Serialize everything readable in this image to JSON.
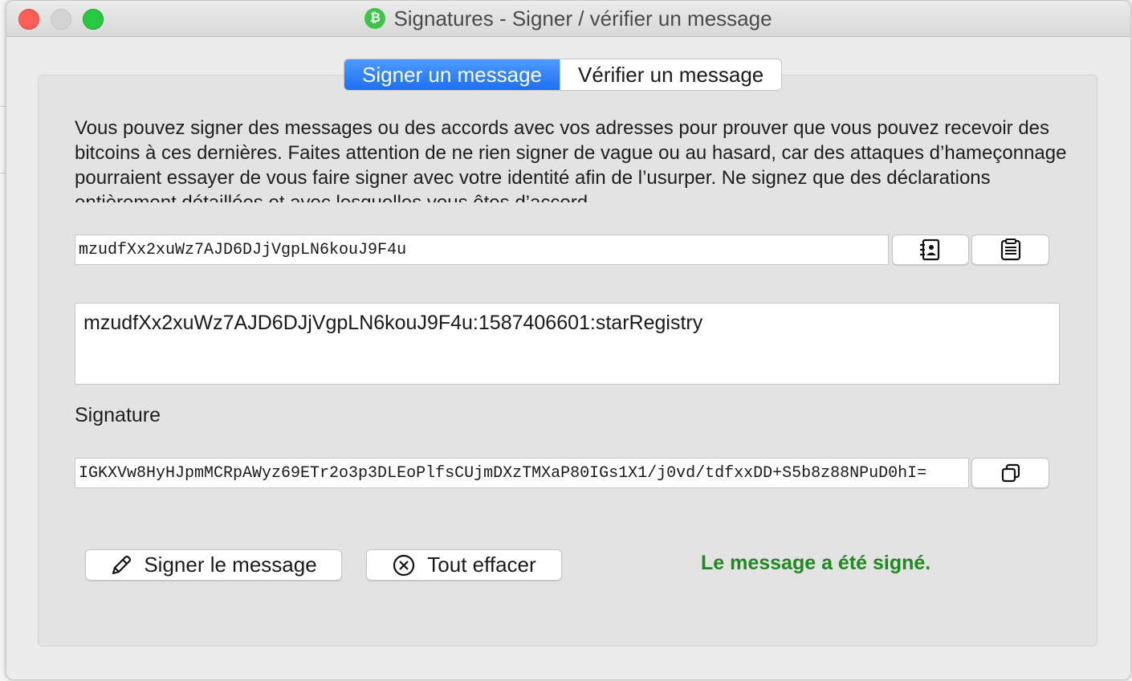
{
  "window": {
    "title": "Signatures - Signer / vérifier un message",
    "app_icon": "bitcoin-icon",
    "controls": [
      "close",
      "minimize",
      "zoom"
    ]
  },
  "tabs": [
    {
      "label": "Signer un message",
      "active": true
    },
    {
      "label": "Vérifier un message",
      "active": false
    }
  ],
  "description": "Vous pouvez signer des messages ou des accords avec vos adresses pour prouver que vous pouvez recevoir des bitcoins à ces dernières. Faites attention de ne rien signer de vague ou au hasard, car des attaques d’hameçonnage pourraient essayer de vous faire signer avec votre identité afin de l’usurper. Ne signez que des déclarations entièrement détaillées et avec lesquelles vous êtes d’accord.",
  "address": {
    "value": "mzudfXx2xuWz7AJD6DJjVgpLN6kouJ9F4u",
    "address_book_icon": "address-book-icon",
    "paste_icon": "clipboard-paste-icon"
  },
  "message": {
    "value": "mzudfXx2xuWz7AJD6DJjVgpLN6kouJ9F4u:1587406601:starRegistry"
  },
  "signature": {
    "label": "Signature",
    "value": "IGKXVw8HyHJpmMCRpAWyz69ETr2o3p3DLEoPlfsCUjmDXzTMXaP80IGs1X1/j0vd/tdfxxDD+S5b8z88NPuD0hI=",
    "copy_icon": "copy-icon"
  },
  "actions": {
    "sign_label": "Signer le message",
    "sign_icon": "pencil-icon",
    "clear_label": "Tout effacer",
    "clear_icon": "clear-circle-icon"
  },
  "status": {
    "text": "Le message a été signé.",
    "color": "#1f8a1f"
  },
  "colors": {
    "active_tab": "#1d6ff1",
    "success": "#1f8a1f"
  }
}
